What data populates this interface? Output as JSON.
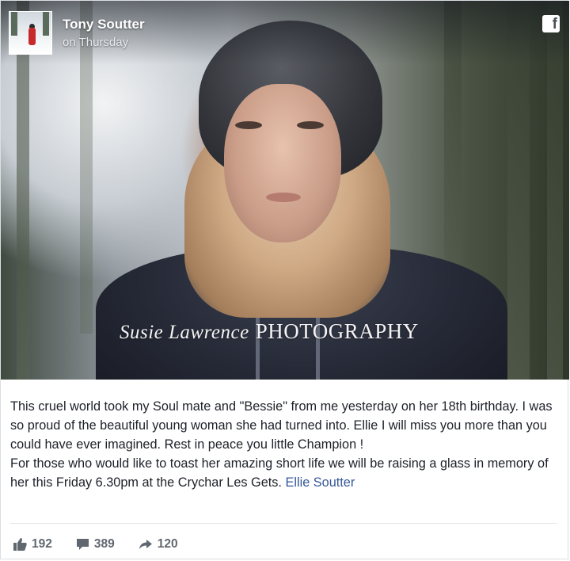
{
  "post": {
    "author": "Tony Soutter",
    "timestamp": "on Thursday",
    "photo_watermark_script": "Susie Lawrence",
    "photo_watermark_caps": "PHOTOGRAPHY",
    "text_paragraph_1": "This cruel world took my Soul mate and \"Bessie\" from me yesterday on her 18th birthday. I was so proud of the beautiful young woman she had turned into. Ellie I will miss you more than you could have ever imagined. Rest in peace you little Champion !",
    "text_paragraph_2": "For those who would like to toast her amazing short life we will be raising a glass in memory of her this Friday 6.30pm at the Crychar Les Gets.",
    "mention": "Ellie Soutter"
  },
  "stats": {
    "likes": "192",
    "comments": "389",
    "shares": "120"
  },
  "icons": {
    "brand": "facebook-icon",
    "like": "thumbs-up-icon",
    "comment": "comment-bubble-icon",
    "share": "share-arrow-icon"
  },
  "colors": {
    "link": "#365899",
    "stat_text": "#616770",
    "body_text": "#1d2129"
  }
}
